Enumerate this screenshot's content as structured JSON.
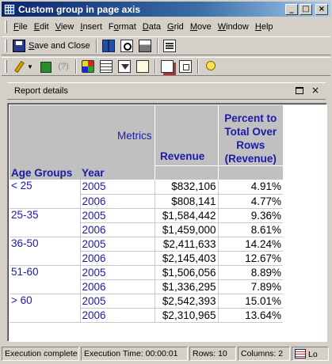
{
  "window": {
    "title": "Custom group in page axis"
  },
  "caption_buttons": {
    "minimize": "_",
    "maximize": "□",
    "close": "×"
  },
  "menu": [
    {
      "label": "File",
      "key": "F",
      "rest": "ile"
    },
    {
      "label": "Edit",
      "key": "E",
      "rest": "dit"
    },
    {
      "label": "View",
      "key": "V",
      "rest": "iew"
    },
    {
      "label": "Insert",
      "key": "I",
      "rest": "nsert"
    },
    {
      "label": "Format",
      "key": "o",
      "pre": "F",
      "rest": "rmat"
    },
    {
      "label": "Data",
      "key": "D",
      "rest": "ata"
    },
    {
      "label": "Grid",
      "key": "G",
      "rest": "rid"
    },
    {
      "label": "Move",
      "key": "M",
      "rest": "ove"
    },
    {
      "label": "Window",
      "key": "W",
      "rest": "indow"
    },
    {
      "label": "Help",
      "key": "H",
      "rest": "elp"
    }
  ],
  "toolbar1": {
    "save_close": {
      "key": "S",
      "rest": "ave and Close"
    },
    "icons": [
      "save-icon",
      "book-icon",
      "print-preview-icon",
      "print-icon",
      "properties-icon"
    ]
  },
  "toolbar2": {
    "icons": [
      "edit-pen-icon",
      "run-icon",
      "sync-icon",
      "multi-icon",
      "grid-view-icon",
      "filter-icon",
      "page-icon",
      "pages-icon",
      "window-icon",
      "bulb-icon"
    ],
    "sync_glyph": "(?)"
  },
  "panel": {
    "title": "Report details",
    "close": "×"
  },
  "report": {
    "metrics_label": "Metrics",
    "row_headers": [
      "Age Groups",
      "Year"
    ],
    "columns": [
      "Revenue",
      "Percent to Total Over Rows (Revenue)"
    ],
    "column2_lines": [
      "Percent to",
      "Total Over",
      "Rows",
      "(Revenue)"
    ],
    "groups": [
      {
        "name": "< 25",
        "rows": [
          {
            "year": "2005",
            "revenue": "$832,106",
            "percent": "4.91%"
          },
          {
            "year": "2006",
            "revenue": "$808,141",
            "percent": "4.77%"
          }
        ]
      },
      {
        "name": "25-35",
        "rows": [
          {
            "year": "2005",
            "revenue": "$1,584,442",
            "percent": "9.36%"
          },
          {
            "year": "2006",
            "revenue": "$1,459,000",
            "percent": "8.61%"
          }
        ]
      },
      {
        "name": "36-50",
        "rows": [
          {
            "year": "2005",
            "revenue": "$2,411,633",
            "percent": "14.24%"
          },
          {
            "year": "2006",
            "revenue": "$2,145,403",
            "percent": "12.67%"
          }
        ]
      },
      {
        "name": "51-60",
        "rows": [
          {
            "year": "2005",
            "revenue": "$1,506,056",
            "percent": "8.89%"
          },
          {
            "year": "2006",
            "revenue": "$1,336,295",
            "percent": "7.89%"
          }
        ]
      },
      {
        "name": "> 60",
        "rows": [
          {
            "year": "2005",
            "revenue": "$2,542,393",
            "percent": "15.01%"
          },
          {
            "year": "2006",
            "revenue": "$2,310,965",
            "percent": "13.64%"
          }
        ]
      }
    ]
  },
  "status": {
    "state": "Execution complete",
    "time": "Execution Time: 00:00:01",
    "rows": "Rows: 10",
    "columns": "Columns: 2",
    "last": "Lo"
  },
  "colors": {
    "titlebar": "#0a246a",
    "header_bg": "#c0c0c0",
    "header_text": "#1a1aa8",
    "chrome": "#d4d0c8"
  }
}
